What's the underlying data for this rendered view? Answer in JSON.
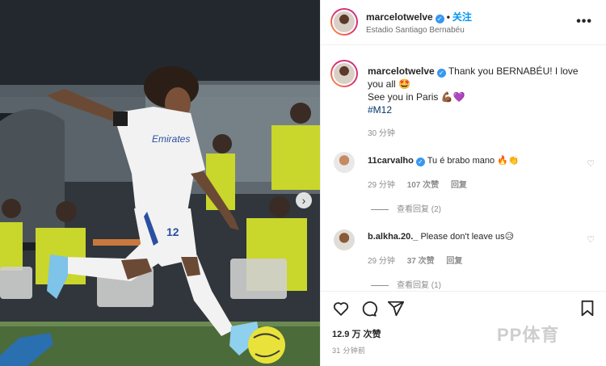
{
  "header": {
    "username": "marcelotwelve",
    "follow_label": "关注",
    "location": "Estadio Santiago Bernabéu",
    "more_label": "•••"
  },
  "caption": {
    "username": "marcelotwelve",
    "text_line1": "Thank you BERNABÉU! I love you all 🤩",
    "text_line2": "See you in Paris 💪🏾💜",
    "hashtag": "#M12",
    "time": "30 分钟"
  },
  "comments": [
    {
      "username": "11carvalho",
      "text": "Tu é brabo mano 🔥👏",
      "time": "29 分钟",
      "likes": "107 次赞",
      "reply_label": "回复",
      "view_replies": "查看回复 (2)"
    },
    {
      "username": "b.alkha.20._",
      "text": "Please don't leave us😥",
      "time": "29 分钟",
      "likes": "37 次赞",
      "reply_label": "回复",
      "view_replies": "查看回复 (1)"
    }
  ],
  "footer": {
    "likes": "12.9 万 次赞",
    "posted": "31 分钟前"
  },
  "watermark": "PP体育",
  "photo": {
    "jersey_number": "12",
    "sponsor_text": "Emirates"
  },
  "colors": {
    "accent": "#0095f6",
    "hashtag": "#00376b",
    "verified": "#3897f0",
    "muted": "#8e8e8e",
    "vest_yellow": "#c9d62b"
  },
  "icons": [
    "verified-badge-icon",
    "more-options-icon",
    "heart-icon",
    "comment-icon",
    "share-icon",
    "bookmark-icon",
    "chevron-right-icon"
  ]
}
